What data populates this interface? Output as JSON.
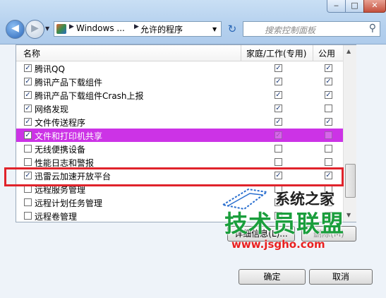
{
  "address": {
    "crumb1": "Windows ...",
    "crumb2": "允许的程序"
  },
  "search": {
    "placeholder": "搜索控制面板"
  },
  "table": {
    "headers": [
      "名称",
      "家庭/工作(专用)",
      "公用"
    ],
    "rows": [
      {
        "name": "腾讯QQ",
        "name_checked": true,
        "home": true,
        "public": true
      },
      {
        "name": "腾讯产品下载组件",
        "name_checked": true,
        "home": true,
        "public": true
      },
      {
        "name": "腾讯产品下载组件Crash上报",
        "name_checked": true,
        "home": true,
        "public": true
      },
      {
        "name": "网络发现",
        "name_checked": true,
        "home": true,
        "public": false
      },
      {
        "name": "文件传送程序",
        "name_checked": true,
        "home": true,
        "public": true
      },
      {
        "name": "文件和打印机共享",
        "name_checked": true,
        "home": true,
        "public": false,
        "highlighted": true
      },
      {
        "name": "无线便携设备",
        "name_checked": false,
        "home": false,
        "public": false
      },
      {
        "name": "性能日志和警报",
        "name_checked": false,
        "home": false,
        "public": false
      },
      {
        "name": "迅雷云加速开放平台",
        "name_checked": true,
        "home": true,
        "public": true
      },
      {
        "name": "远程服务管理",
        "name_checked": false,
        "home": false,
        "public": false
      },
      {
        "name": "远程计划任务管理",
        "name_checked": false,
        "home": false,
        "public": false
      },
      {
        "name": "远程卷管理",
        "name_checked": false,
        "home": false,
        "public": false
      }
    ]
  },
  "buttons": {
    "details": "详细信息(L)...",
    "remove": "删除(M)",
    "ok": "确定",
    "cancel": "取消"
  },
  "watermark": {
    "line1": "系统之家",
    "line2": "技术员联盟",
    "line3": "www.jsgho.com"
  },
  "colors": {
    "highlight": "#cc33e6",
    "annotation": "#e0232b"
  }
}
